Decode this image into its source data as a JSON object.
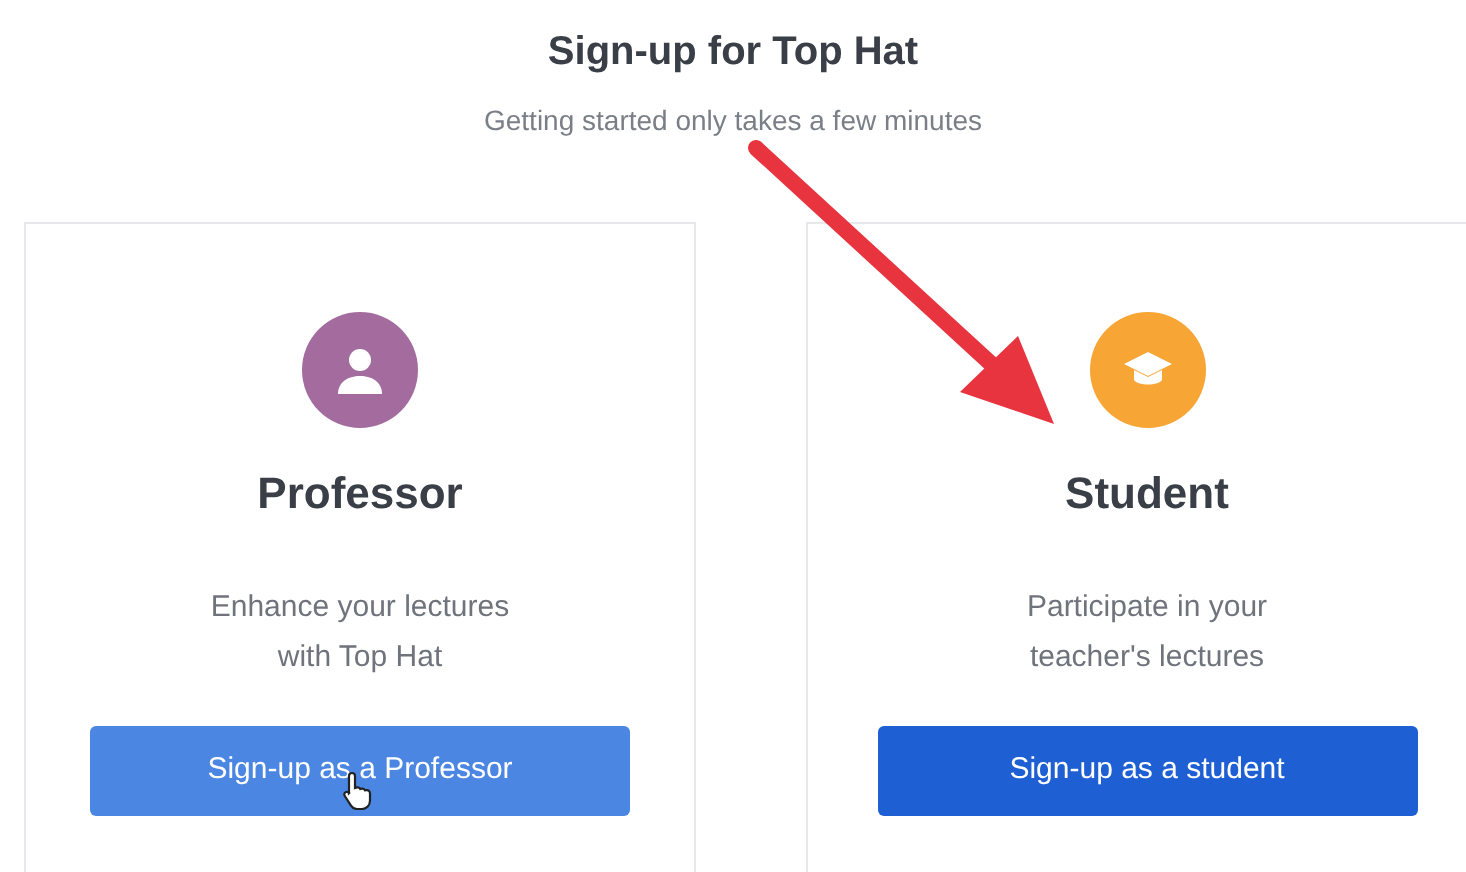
{
  "header": {
    "title": "Sign-up for Top Hat",
    "subtitle": "Getting started only takes a few minutes"
  },
  "cards": [
    {
      "kind": "professor",
      "role": "Professor",
      "description": "Enhance your lectures with Top Hat",
      "button": "Sign-up as a Professor",
      "hovered": true,
      "color": "#a46c9e"
    },
    {
      "kind": "student",
      "role": "Student",
      "description": "Participate in your teacher's lectures",
      "button": "Sign-up as a student",
      "hovered": false,
      "color": "#f7a535"
    }
  ],
  "annotation": {
    "kind": "arrow"
  }
}
